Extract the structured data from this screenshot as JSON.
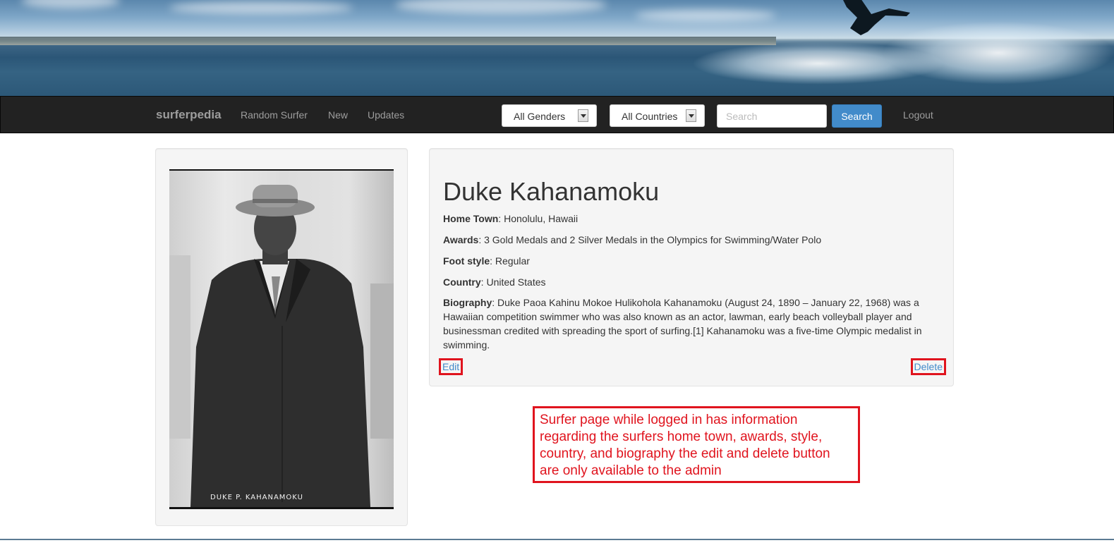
{
  "navbar": {
    "brand": "surferpedia",
    "links": [
      "Random Surfer",
      "New",
      "Updates"
    ],
    "gender_filter": "All Genders",
    "country_filter": "All Countries",
    "search_placeholder": "Search",
    "search_button": "Search",
    "logout": "Logout"
  },
  "photo": {
    "caption": "DUKE P. KAHANAMOKU"
  },
  "surfer": {
    "name": "Duke Kahanamoku",
    "home_town_label": "Home Town",
    "home_town": "Honolulu, Hawaii",
    "awards_label": "Awards",
    "awards": "3 Gold Medals and 2 Silver Medals in the Olympics for Swimming/Water Polo",
    "foot_style_label": "Foot style",
    "foot_style": "Regular",
    "country_label": "Country",
    "country": "United States",
    "biography_label": "Biography",
    "biography": "Duke Paoa Kahinu Mokoe Hulikohola Kahanamoku (August 24, 1890 – January 22, 1968) was a Hawaiian competition swimmer who was also known as an actor, lawman, early beach volleyball player and businessman credited with spreading the sport of surfing.[1] Kahanamoku was a five-time Olympic medalist in swimming.",
    "separator": ": "
  },
  "actions": {
    "edit": "Edit",
    "delete": "Delete"
  },
  "annotation": {
    "text": "Surfer page while logged in has information regarding the surfers home town, awards, style, country, and biography the edit and delete button are only available to the admin"
  },
  "colors": {
    "navbar_bg": "#222222",
    "link": "#428bca",
    "annotation": "#e0141e"
  }
}
